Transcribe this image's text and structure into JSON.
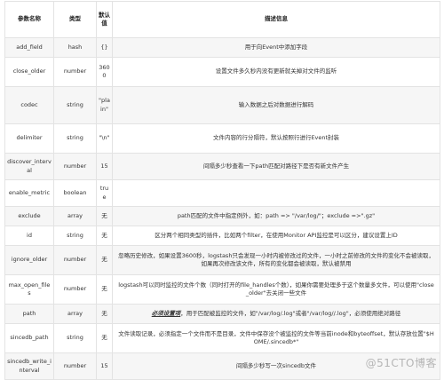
{
  "table": {
    "headers": [
      "参数名称",
      "类型",
      "默认值",
      "描述信息"
    ],
    "rows": [
      {
        "name": "add_field",
        "type": "hash",
        "default": "{}",
        "desc": "用于向Event中添加字段"
      },
      {
        "name": "close_older",
        "type": "number",
        "default": "3600",
        "desc": "设置文件多久秒内没有更新就关掉对文件的监听"
      },
      {
        "name": "codec",
        "type": "string",
        "default": "\"plain\"",
        "desc": "输入数据之后对数据进行解码"
      },
      {
        "name": "delimiter",
        "type": "string",
        "default": "\"\\n\"",
        "desc": "文件内容的行分隔符，默认按照行进行Event封装"
      },
      {
        "name": "discover_interval",
        "type": "number",
        "default": "15",
        "desc": "间隔多少秒查看一下path匹配对路径下是否有新文件产生"
      },
      {
        "name": "enable_metric",
        "type": "boolean",
        "default": "true",
        "desc": ""
      },
      {
        "name": "exclude",
        "type": "array",
        "default": "无",
        "desc": "path匹配的文件中指定例外，如：path => \"/var/log/\"；exclude =>\".gz\""
      },
      {
        "name": "id",
        "type": "string",
        "default": "无",
        "desc": "区分两个相同类型的插件，比如两个filter，在使用Monitor API监控是可以区分，建议设置上ID"
      },
      {
        "name": "ignore_older",
        "type": "number",
        "default": "无",
        "desc": "忽略历史修改，如果设置3600秒，logstash只会发现一小时内被修改过的文件，一小时之前修改的文件的变化不会被读取，如果再次修改该文件，所有的变化都会被读取，默认被禁用"
      },
      {
        "name": "max_open_files",
        "type": "number",
        "default": "无",
        "desc": "logstash可以同时监控的文件个数（同时打开的file_handles个数），如果你需要处理多于这个数量多文件，可以使用\"close_older\"去关闭一些文件"
      },
      {
        "name": "path",
        "type": "array",
        "default": "无",
        "desc_emph": "必须设置项",
        "desc": "，用于匹配被监控的文件，如\"/var/log/.log\"或者\"/var/log//.log\"，必须使用绝对路径"
      },
      {
        "name": "sincedb_path",
        "type": "string",
        "default": "无",
        "desc": "文件读取记录，必须指定一个文件而不是目录，文件中保存没个被监控的文件等当前inode和byteoffset，默认存放位置\"$HOME/.sincedb*\""
      },
      {
        "name": "sincedb_write_interval",
        "type": "number",
        "default": "15",
        "desc": "间隔多少秒写一次sincedb文件"
      }
    ]
  },
  "watermark": "@51CTO博客"
}
